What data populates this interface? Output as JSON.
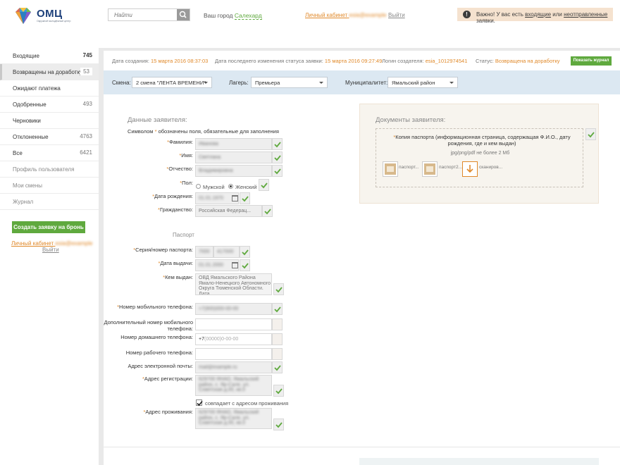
{
  "header": {
    "logo_text": "ОМЦ",
    "logo_sub": "Окружной молодёжный центр",
    "search_placeholder": "Найти",
    "city_label": "Ваш город",
    "city_name": "Салехард",
    "lk_label": "Личный кабинет",
    "lk_user": "esia@example",
    "exit_label": "Выйти",
    "notice_icon": "!",
    "notice_prefix": "Важно! У вас есть",
    "notice_link1": "входящие",
    "notice_mid": "или",
    "notice_link2": "неотправленные",
    "notice_suffix": "заявки."
  },
  "sidebar": {
    "items": [
      {
        "label": "Входящие",
        "count": "745"
      },
      {
        "label": "Возвращены на доработку",
        "count": "53"
      },
      {
        "label": "Ожидают платежа",
        "count": ""
      },
      {
        "label": "Одобренные",
        "count": "493"
      },
      {
        "label": "Черновики",
        "count": ""
      },
      {
        "label": "Отклоненные",
        "count": "4763"
      },
      {
        "label": "Все",
        "count": "6421"
      },
      {
        "label": "Профиль пользователя",
        "count": ""
      },
      {
        "label": "Мои смены",
        "count": ""
      },
      {
        "label": "Журнал",
        "count": ""
      }
    ],
    "create_button": "Создать заявку на бронь",
    "lk_label": "Личный кабинет",
    "lk_user": "esia@example",
    "exit_label": "Выйти"
  },
  "info": {
    "created_label": "Дата создания:",
    "created_value": "15 марта 2016 08:37:03",
    "changed_label": "Дата последнего изменения статуса заявки:",
    "changed_value": "15 марта 2016 09:27:49",
    "login_label": "Логин создателя:",
    "login_value": "esia_1012974541",
    "status_label": "Статус:",
    "status_value": "Возвращена на доработку",
    "log_button": "Показать журнал"
  },
  "filters": {
    "shift_label": "Смена:",
    "shift_value": "2 смена \"ЛЕНТА ВРЕМЕНИ\"",
    "camp_label": "Лагерь:",
    "camp_value": "Премьера",
    "muni_label": "Муниципалитет:",
    "muni_value": "Ямальский район"
  },
  "form": {
    "title": "Данные заявителя:",
    "hint_prefix": "Символом",
    "hint_star": "*",
    "hint_suffix": "обозначены поля, обязательные для заполнения",
    "req": "*",
    "surname_label": "Фамилия:",
    "surname_value": "Ивановa",
    "name_label": "Имя:",
    "name_value": "Светлана",
    "patronymic_label": "Отчество:",
    "patronymic_value": "Владимировна",
    "gender_label": "Пол:",
    "gender_male": "Мужской",
    "gender_female": "Женский",
    "birth_label": "Дата рождения:",
    "birth_value": "01.01.1970",
    "citizenship_label": "Гражданство:",
    "citizenship_value": "Российская Федерац...",
    "passport_title": "Паспорт",
    "series_label": "Серия/номер паспорта:",
    "series_value": "7000",
    "number_value": "417000",
    "issue_label": "Дата выдачи:",
    "issue_value": "01.01.2000",
    "issuer_label": "Кем выдан:",
    "issuer_value": "ОВД Ямальского Района Ямало-Ненецкого Автономного Округа Тюменской Области. Дата",
    "mobile_label": "Номер мобильного телефона:",
    "mobile_value": "+7(900)000-00-00",
    "mobile2_label": "Дополнительный номер мобильного телефона:",
    "home_label": "Номер домашнего телефона:",
    "home_prefix": "+7",
    "home_placeholder": "(00000)0-00-00",
    "work_label": "Номер рабочего телефона:",
    "email_label": "Адрес электронной почты:",
    "email_value": "mail@example.ru",
    "reg_label": "Адрес регистрации:",
    "reg_value": "629700 ЯНАО, Ямальский район, с. Яр-Сале, ул. Советская д.00, кв.0",
    "same_label": "совпадает с адресом проживания",
    "live_label": "Адрес проживания:",
    "live_value": "629700 ЯНАО, Ямальский район, с. Яр-Сале, ул. Советская д.00, кв.0"
  },
  "docs": {
    "title": "Документы заявителя:",
    "req": "*",
    "doc_title": "Копия паспорта (информационная страница, содержащая Ф.И.О., дату рождения, где и кем выдан)",
    "hint": "jpg/png/pdf не более 2 Мб",
    "file1": "паспорт...",
    "file2": "паспорт2...",
    "file3": "сканиров..."
  },
  "colors": {
    "accent_green": "#5fa93e",
    "accent_orange": "#e0892a",
    "filter_bg": "#dce8f2"
  }
}
